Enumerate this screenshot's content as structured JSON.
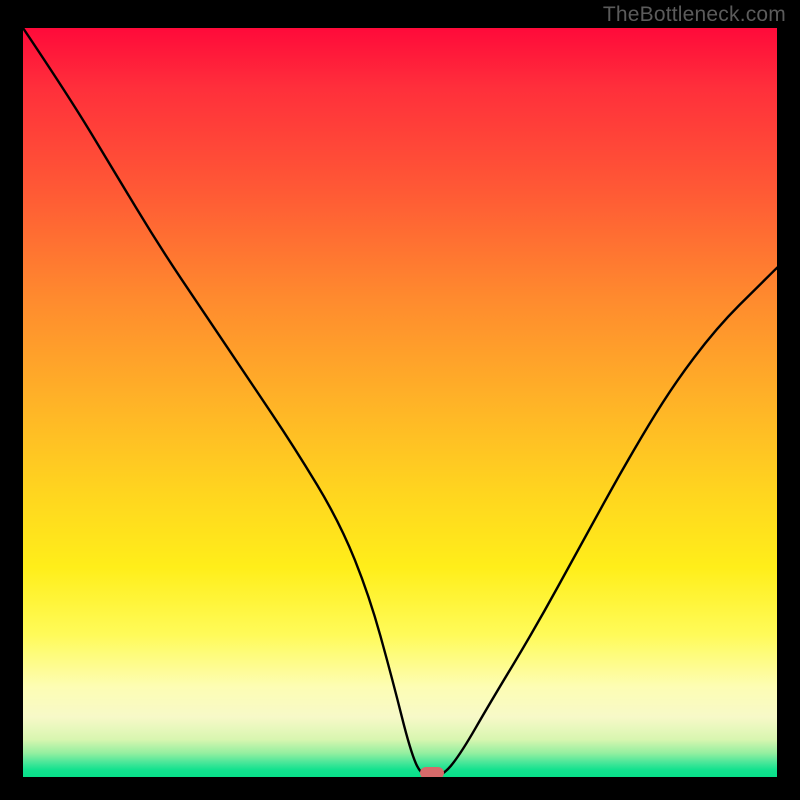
{
  "watermark": {
    "text": "TheBottleneck.com"
  },
  "colors": {
    "curve": "#000000",
    "marker": "#d66a6a",
    "frame": "#000000"
  },
  "chart_data": {
    "type": "line",
    "title": "",
    "xlabel": "",
    "ylabel": "",
    "xlim": [
      0,
      100
    ],
    "ylim": [
      0,
      100
    ],
    "grid": false,
    "legend": false,
    "series": [
      {
        "name": "bottleneck-curve",
        "x": [
          0,
          6,
          12,
          18,
          24,
          30,
          36,
          42,
          46,
          49,
          51.5,
          53,
          55.5,
          58,
          62,
          68,
          74,
          80,
          86,
          92,
          98,
          100
        ],
        "y": [
          100,
          91,
          81,
          71,
          62,
          53,
          44,
          34,
          24,
          13,
          3,
          0,
          0,
          3,
          10,
          20,
          31,
          42,
          52,
          60,
          66,
          68
        ]
      }
    ],
    "marker": {
      "x": 54.3,
      "y": 0.6
    },
    "background_gradient": [
      {
        "stop": 0.0,
        "color": "#ff0a3a"
      },
      {
        "stop": 0.5,
        "color": "#ffd51f"
      },
      {
        "stop": 0.88,
        "color": "#fdfdb4"
      },
      {
        "stop": 1.0,
        "color": "#07df89"
      }
    ]
  }
}
